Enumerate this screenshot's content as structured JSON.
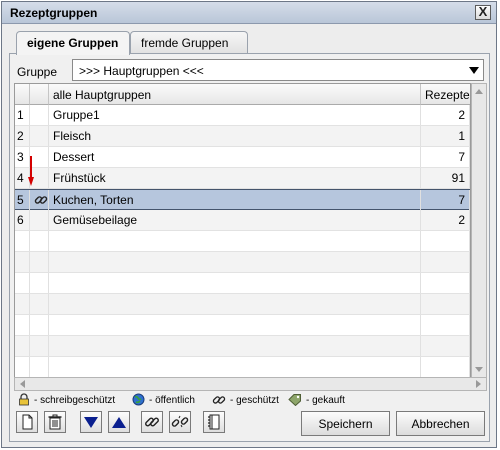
{
  "window": {
    "title": "Rezeptgruppen",
    "close_glyph": "X"
  },
  "tabs": [
    {
      "label": "eigene Gruppen",
      "active": true
    },
    {
      "label": "fremde Gruppen",
      "active": false
    }
  ],
  "gruppe": {
    "label": "Gruppe",
    "value": ">>> Hauptgruppen <<<"
  },
  "table": {
    "headers": {
      "num": "",
      "icon": "",
      "name": "alle Hauptgruppen",
      "count": "Rezepte"
    },
    "rows": [
      {
        "num": "1",
        "name": "Gruppe1",
        "count": "2",
        "icon": ""
      },
      {
        "num": "2",
        "name": "Fleisch",
        "count": "1",
        "icon": ""
      },
      {
        "num": "3",
        "name": "Dessert",
        "count": "7",
        "icon": ""
      },
      {
        "num": "4",
        "name": "Frühstück",
        "count": "91",
        "icon": ""
      },
      {
        "num": "5",
        "name": "Kuchen, Torten",
        "count": "7",
        "icon": "chain-link-icon",
        "selected": true
      },
      {
        "num": "6",
        "name": "Gemüsebeilage",
        "count": "2",
        "icon": ""
      }
    ]
  },
  "legend": {
    "read_only": "- schreibgeschützt",
    "public": "- öffentlich",
    "protected": "- geschützt",
    "bought": "- gekauft"
  },
  "buttons": {
    "save": "Speichern",
    "cancel": "Abbrechen"
  },
  "colors": {
    "selection": "#b6c6dd",
    "arrow_blue": "#0a1f8f",
    "annotation_red": "#d40000"
  }
}
